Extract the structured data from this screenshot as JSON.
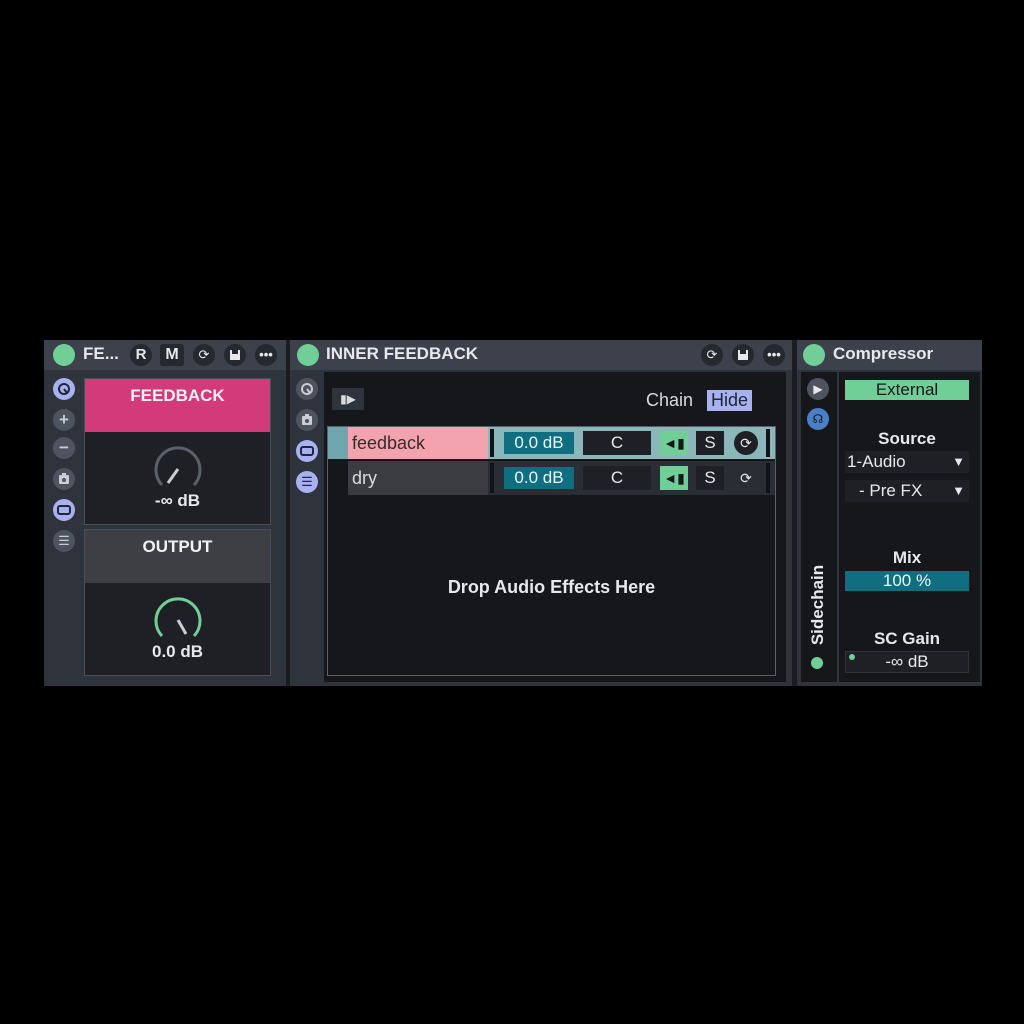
{
  "colors": {
    "accent_green": "#6fcf97",
    "accent_pink": "#d23a7a",
    "accent_blue": "#a8b2f0",
    "teal": "#0f6f80"
  },
  "rack1": {
    "title": "FE...",
    "r_label": "R",
    "m_label": "M",
    "icons": [
      "refresh-icon",
      "save-icon",
      "more-icon"
    ],
    "side_icons": [
      "macro-icon",
      "plus-icon",
      "minus-icon",
      "random-icon",
      "chain-view-icon",
      "list-icon"
    ],
    "macros": [
      {
        "name": "FEEDBACK",
        "value": "-∞ dB",
        "color": "#d23a7a"
      },
      {
        "name": "OUTPUT",
        "value": "0.0 dB",
        "color": "#3d3f44"
      }
    ]
  },
  "rack2": {
    "title": "INNER FEEDBACK",
    "icons": [
      "refresh-icon",
      "save-icon",
      "more-icon"
    ],
    "chain_label": "Chain",
    "hide_label": "Hide",
    "chains": [
      {
        "name": "feedback",
        "volume": "0.0 dB",
        "c_label": "C",
        "s_label": "S",
        "selected": true
      },
      {
        "name": "dry",
        "volume": "0.0 dB",
        "c_label": "C",
        "s_label": "S",
        "selected": false
      }
    ],
    "drop_text": "Drop Audio Effects Here"
  },
  "compressor": {
    "title": "Compressor",
    "external_label": "External",
    "source_label": "Source",
    "source_value": "1-Audio",
    "tap_value": "- Pre FX",
    "mix_label": "Mix",
    "mix_value": "100 %",
    "mix_level": 1.0,
    "sc_gain_label": "SC Gain",
    "sc_gain_value": "-∞ dB",
    "sidechain_label": "Sidechain"
  }
}
